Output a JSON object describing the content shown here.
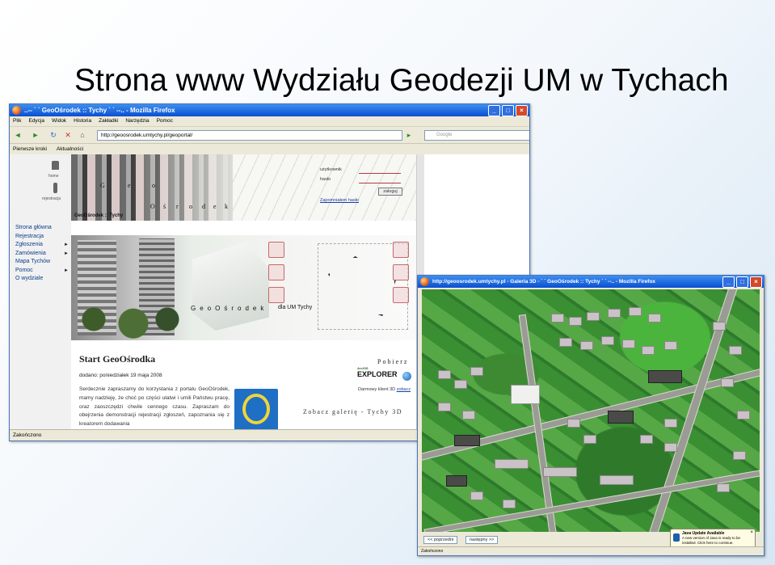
{
  "slide": {
    "title": "Strona www Wydziału Geodezji UM w Tychach"
  },
  "browser1": {
    "window_title": "..-- ` ` GeoOśrodek :: Tychy ` ` --.. - Mozilla Firefox",
    "menu": [
      "Plik",
      "Edycja",
      "Widok",
      "Historia",
      "Zakładki",
      "Narzędzia",
      "Pomoc"
    ],
    "url": "http://geoosrodek.umtychy.pl/geoportal/",
    "search_placeholder": "Google",
    "bookmarks": [
      "Pierwsze kroki",
      "Aktualności"
    ],
    "status": "Zakończono"
  },
  "site": {
    "home_label": "home",
    "register_label": "rejestracja",
    "brand_letters": [
      "G",
      "e",
      "o",
      "O",
      "ś",
      "r",
      "o",
      "d",
      "e",
      "k"
    ],
    "brand_caption": "GeoOśrodek :: Tychy",
    "login": {
      "user_label": "użytkownik",
      "password_label": "hasło",
      "button": "zaloguj",
      "forgot": "Zapomniałem hasło"
    },
    "menu": [
      {
        "label": "Strona główna",
        "arrow": ""
      },
      {
        "label": "Rejestracja",
        "arrow": ""
      },
      {
        "label": "Zgłoszenia",
        "arrow": "►"
      },
      {
        "label": "Zamówienia",
        "arrow": "►"
      },
      {
        "label": "Mapa Tychów",
        "arrow": ""
      },
      {
        "label": "Pomoc",
        "arrow": "►"
      },
      {
        "label": "O wydziale",
        "arrow": ""
      }
    ],
    "banner_text": "GeoOśrodek",
    "banner_text2": "dla UM Tychy",
    "start_title": "Start GeoOśrodka",
    "date_line": "dodano: poniedziałek 19 maja 2008",
    "body_text": "Serdecznie zapraszamy do korzystania z portalu GeoOśrodek, mamy nadzieję, że choć po części ułatwi i umili Państwu pracę, oraz zaoszczędzi chwile cennego czasu. Zapraszam do obejrzenia demonstracji rejestracji zgłoszeń, zapoznania się z kreatorem dodawania",
    "pobierz": "Pobierz",
    "explorer_small": "ArcGIS",
    "explorer_big": "EXPLORER",
    "darmowy": "Darmowy klient 3D",
    "zobacz": "zobacz",
    "galeria": "Zobacz galerię - Tychy 3D"
  },
  "browser2": {
    "window_title": "http://geoosrodek.umtychy.pl - Galeria 3D - ` ` GeoOśrodek :: Tychy ` ` --.. - Mozilla Firefox",
    "prev": "<< poprzedni",
    "next": "następny >>",
    "java_title": "Java Update Available",
    "java_text": "A new version of Java is ready to be installed. Click here to continue.",
    "status": "Zakończono"
  },
  "colors": {
    "titlebar": "#0a4fd2",
    "link": "#0a3d8f",
    "grass": "#3f8f36"
  }
}
